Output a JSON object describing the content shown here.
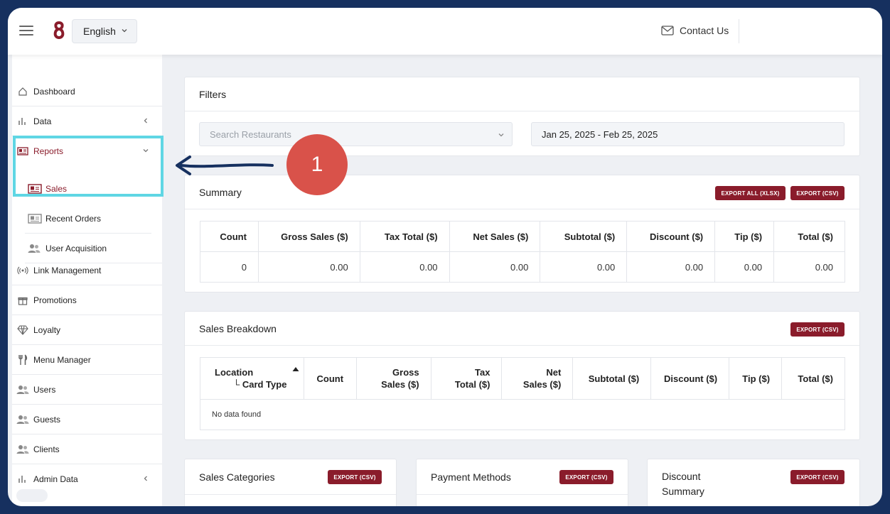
{
  "topbar": {
    "language": "English",
    "contact_label": "Contact Us"
  },
  "sidebar": {
    "items": [
      {
        "label": "Dashboard",
        "icon": "home-icon"
      },
      {
        "label": "Data",
        "icon": "bar-chart-icon"
      },
      {
        "label": "Reports",
        "icon": "report-icon"
      },
      {
        "label": "Sales",
        "icon": "report-icon"
      },
      {
        "label": "Recent Orders",
        "icon": "report-icon"
      },
      {
        "label": "User Acquisition",
        "icon": "users-icon"
      },
      {
        "label": "Link Management",
        "icon": "broadcast-icon"
      },
      {
        "label": "Promotions",
        "icon": "gift-icon"
      },
      {
        "label": "Loyalty",
        "icon": "diamond-icon"
      },
      {
        "label": "Menu Manager",
        "icon": "utensils-icon"
      },
      {
        "label": "Users",
        "icon": "users-icon"
      },
      {
        "label": "Guests",
        "icon": "users-icon"
      },
      {
        "label": "Clients",
        "icon": "users-icon"
      },
      {
        "label": "Admin Data",
        "icon": "bar-chart-icon"
      }
    ]
  },
  "filters": {
    "title": "Filters",
    "search_placeholder": "Search Restaurants",
    "date_range": "Jan 25, 2025 - Feb 25, 2025"
  },
  "summary": {
    "title": "Summary",
    "export_all": "EXPORT ALL (XLSX)",
    "export_csv": "EXPORT (CSV)",
    "columns": [
      "Count",
      "Gross Sales ($)",
      "Tax Total ($)",
      "Net Sales ($)",
      "Subtotal ($)",
      "Discount ($)",
      "Tip ($)",
      "Total ($)"
    ],
    "row": [
      "0",
      "0.00",
      "0.00",
      "0.00",
      "0.00",
      "0.00",
      "0.00",
      "0.00"
    ]
  },
  "breakdown": {
    "title": "Sales Breakdown",
    "export_csv": "EXPORT (CSV)",
    "col_location": "Location",
    "col_card_type": "└ Card Type",
    "col_count": "Count",
    "col_gross_1": "Gross",
    "col_gross_2": "Sales ($)",
    "col_tax_1": "Tax",
    "col_tax_2": "Total ($)",
    "col_net_1": "Net",
    "col_net_2": "Sales ($)",
    "col_subtotal": "Subtotal ($)",
    "col_discount": "Discount ($)",
    "col_tip": "Tip ($)",
    "col_total": "Total ($)",
    "empty": "No data found"
  },
  "bottom_cards": {
    "categories_title": "Sales Categories",
    "payment_title": "Payment Methods",
    "discount_title_1": "Discount",
    "discount_title_2": "Summary",
    "export_csv": "EXPORT (CSV)"
  },
  "annotation": {
    "step": "1"
  },
  "colors": {
    "brand": "#8a1c2b",
    "highlight": "#5fd6e4",
    "annotation_badge": "#d9524a",
    "arrow": "#16305f"
  }
}
